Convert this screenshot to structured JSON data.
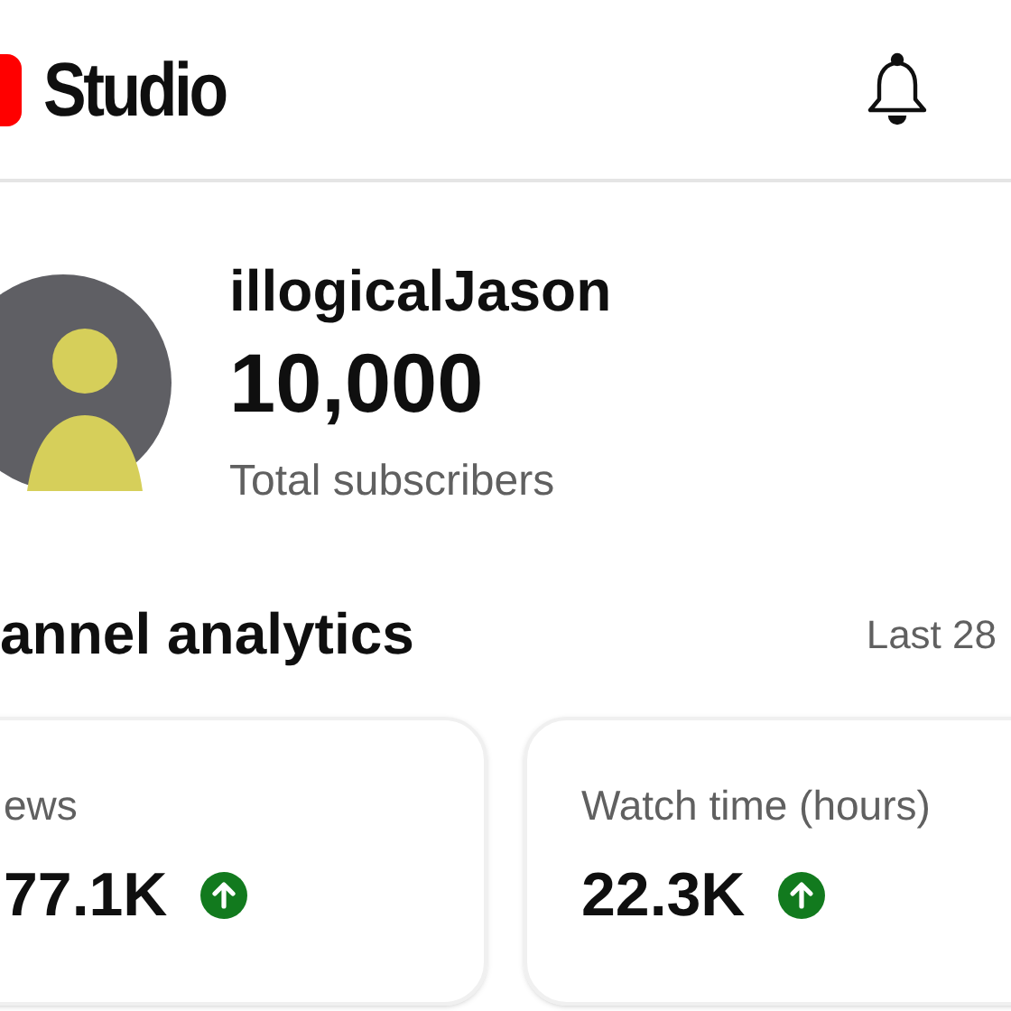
{
  "header": {
    "logo_text": "Studio"
  },
  "channel": {
    "name": "illogicalJason",
    "subscribers": "10,000",
    "subscribers_label": "Total subscribers"
  },
  "analytics": {
    "title": "annel analytics",
    "period": "Last 28",
    "cards": [
      {
        "label": "ews",
        "value": "77.1K",
        "trend_up": true
      },
      {
        "label": "Watch time (hours)",
        "value": "22.3K",
        "trend_up": true
      }
    ]
  }
}
